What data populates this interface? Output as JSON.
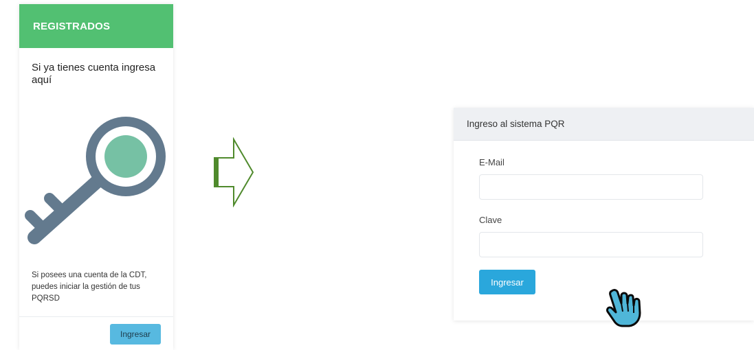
{
  "registered_card": {
    "header": "REGISTRADOS",
    "title": "Si ya tienes cuenta ingresa aquí",
    "description": "Si posees una cuenta de la CDT, puedes iniciar la gestión de tus PQRSD",
    "button_label": "Ingresar",
    "header_color": "#52c072",
    "key_icon": "key-icon",
    "key_color": "#637a8e",
    "key_accent_color": "#76c1a4"
  },
  "arrow": {
    "icon": "right-arrow-icon",
    "color": "#4f8a2c"
  },
  "login_panel": {
    "title": "Ingreso al sistema PQR",
    "email_label": "E-Mail",
    "email_value": "",
    "password_label": "Clave",
    "password_value": "",
    "submit_label": "Ingresar",
    "submit_color": "#2aa7dc"
  },
  "cursor": {
    "icon": "hand-pointer-icon",
    "color": "#4fb6d8"
  }
}
